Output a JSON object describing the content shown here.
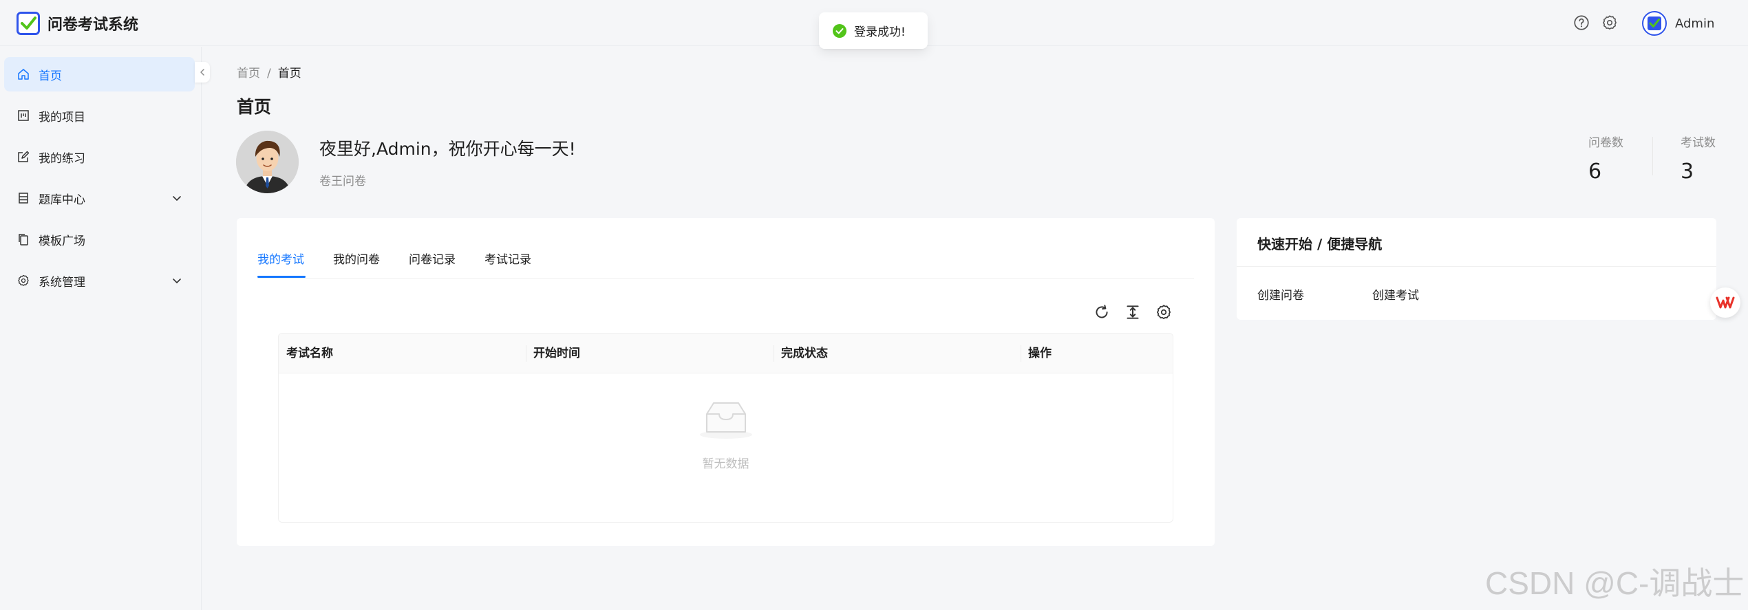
{
  "app": {
    "title": "问卷考试系统"
  },
  "header": {
    "user_name": "Admin"
  },
  "toast": {
    "message": "登录成功!"
  },
  "sidebar": {
    "items": [
      {
        "label": "首页",
        "icon": "home-icon",
        "active": true
      },
      {
        "label": "我的项目",
        "icon": "project-icon"
      },
      {
        "label": "我的练习",
        "icon": "edit-icon"
      },
      {
        "label": "题库中心",
        "icon": "database-icon",
        "expandable": true
      },
      {
        "label": "模板广场",
        "icon": "copy-icon"
      },
      {
        "label": "系统管理",
        "icon": "gear-icon",
        "expandable": true
      }
    ]
  },
  "breadcrumb": {
    "root": "首页",
    "separator": "/",
    "current": "首页"
  },
  "page": {
    "title": "首页"
  },
  "profile": {
    "greeting": "夜里好,Admin，祝你开心每一天!",
    "subtitle": "卷王问卷"
  },
  "stats": [
    {
      "label": "问卷数",
      "value": "6"
    },
    {
      "label": "考试数",
      "value": "3"
    }
  ],
  "tabs": [
    "我的考试",
    "我的问卷",
    "问卷记录",
    "考试记录"
  ],
  "table": {
    "columns": [
      "考试名称",
      "开始时间",
      "完成状态",
      "操作"
    ],
    "empty_text": "暂无数据"
  },
  "quick_nav": {
    "title": "快速开始 / 便捷导航",
    "links": [
      "创建问卷",
      "创建考试"
    ]
  },
  "watermark": "CSDN @C-调战士",
  "colors": {
    "primary": "#1677ff",
    "success": "#52c41a",
    "active_bg": "#e3eefd"
  }
}
